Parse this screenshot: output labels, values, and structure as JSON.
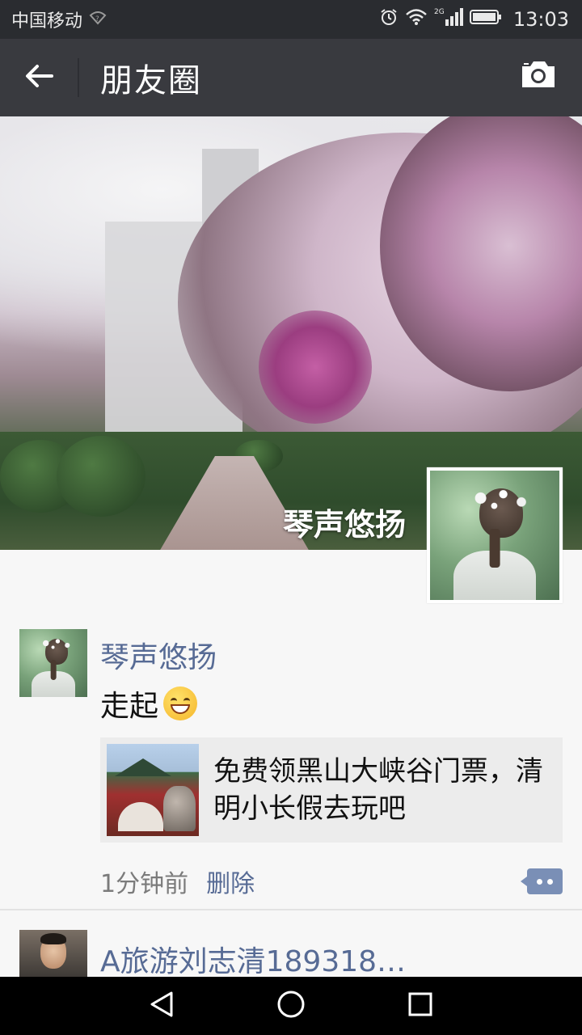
{
  "status_bar": {
    "carrier": "中国移动",
    "network": "2G",
    "time": "13:03",
    "icons": [
      "wifi-faint-icon",
      "alarm-icon",
      "wifi-icon",
      "signal-icon",
      "battery-icon"
    ]
  },
  "app_bar": {
    "title": "朋友圈",
    "icons": [
      "back-arrow-icon",
      "camera-icon"
    ]
  },
  "cover": {
    "user_name": "琴声悠扬"
  },
  "posts": [
    {
      "author": "琴声悠扬",
      "text": "走起",
      "emoji": "grinning-face-icon",
      "link": {
        "title": "免费领黑山大峡谷门票，清明小长假去玩吧"
      },
      "time": "1分钟前",
      "delete_label": "删除"
    },
    {
      "author": "A旅游刘志清189318…"
    }
  ],
  "nav_bar": {
    "icons": [
      "nav-back-icon",
      "nav-home-icon",
      "nav-recents-icon"
    ]
  },
  "colors": {
    "status_bar_bg": "#2a2c30",
    "app_bar_bg": "#393a3f",
    "link_name": "#576b95",
    "page_bg": "#f7f7f7"
  }
}
